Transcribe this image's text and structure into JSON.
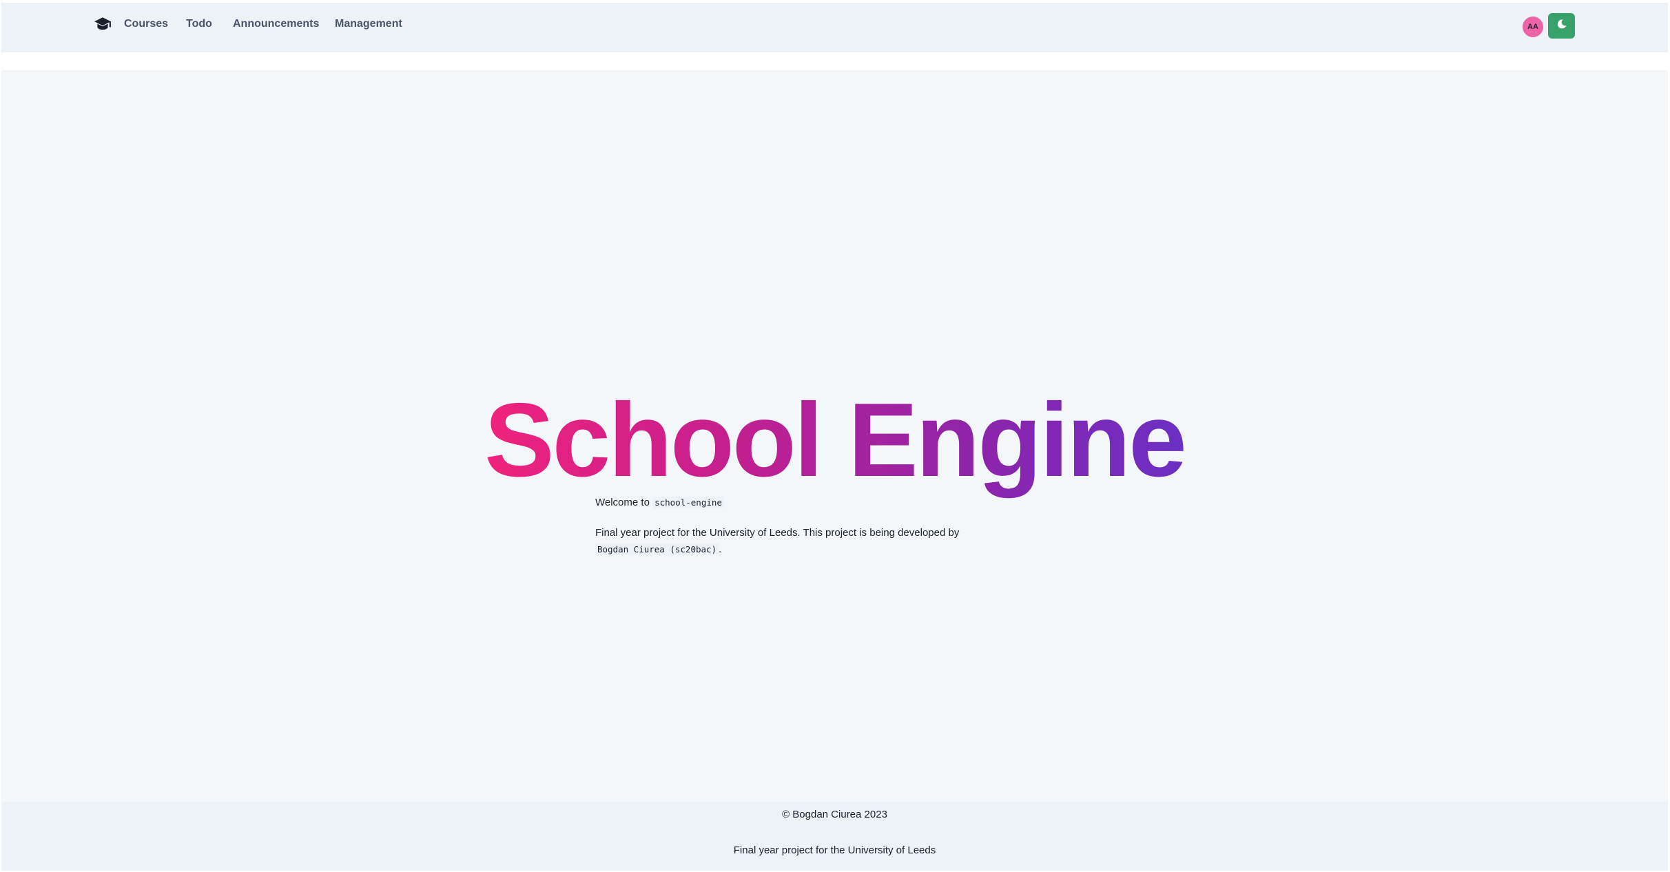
{
  "navbar": {
    "brand_icon": "graduation-cap-icon",
    "links": [
      {
        "label": "Courses"
      },
      {
        "label": "Todo"
      },
      {
        "label": "Announcements"
      },
      {
        "label": "Management"
      }
    ],
    "avatar_initials": "AA",
    "avatar_color": "#ed64a6",
    "theme_toggle_icon": "moon-icon",
    "theme_toggle_color": "#38a169"
  },
  "hero": {
    "title": "School Engine",
    "gradient_colors": [
      "#f0237c",
      "#8e24aa",
      "#6b2fc4"
    ]
  },
  "content": {
    "welcome_prefix": "Welcome to",
    "welcome_code": "school-engine",
    "description": "Final year project for the University of Leeds. This project is being developed by",
    "author_code": "Bogdan Ciurea (sc20bac)",
    "author_suffix": "."
  },
  "footer": {
    "copyright": "© Bogdan Ciurea 2023",
    "subtitle": "Final year project for the University of Leeds"
  }
}
